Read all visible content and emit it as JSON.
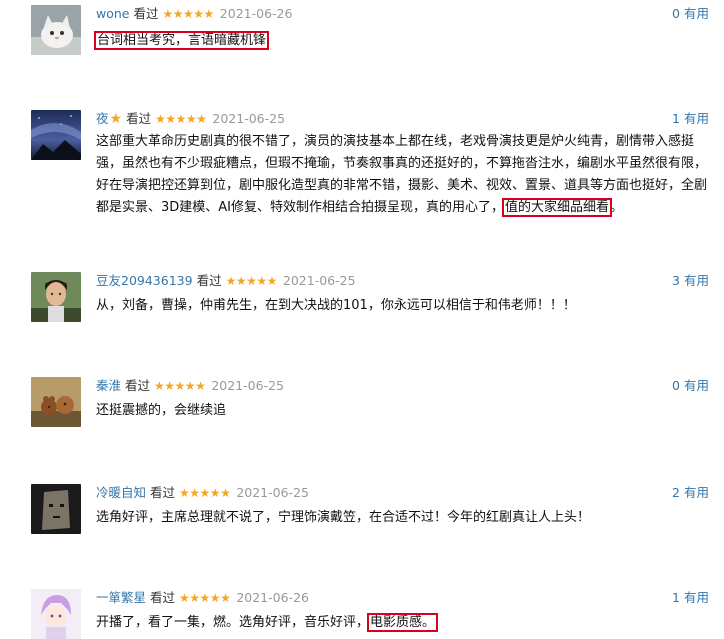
{
  "comments": [
    {
      "user": "wone",
      "seen": "看过",
      "stars": "★★★★★",
      "date": "2021-06-26",
      "votes": "0",
      "votes_label": "有用",
      "text_plain": "",
      "text_highlight": "台词相当考究，言语暗藏机锋",
      "avatar_icon": "cat-avatar-icon"
    },
    {
      "user": "夜",
      "badge_icon": "star-badge-icon",
      "seen": "看过",
      "stars": "★★★★★",
      "date": "2021-06-25",
      "votes": "1",
      "votes_label": "有用",
      "text_plain": "这部重大革命历史剧真的很不错了，演员的演技基本上都在线，老戏骨演技更是炉火纯青，剧情带入感挺强，虽然也有不少瑕疵糟点，但瑕不掩瑜，节奏叙事真的还挺好的，不算拖沓注水，编剧水平虽然很有限，好在导演把控还算到位，剧中服化造型真的非常不错，摄影、美术、视效、置景、道具等方面也挺好，全剧都是实景、3D建模、AI修复、特效制作相结合拍摄呈现，真的用心了，",
      "text_highlight": "值的大家细品细看",
      "text_tail": "。",
      "avatar_icon": "night-sky-avatar-icon"
    },
    {
      "user": "豆友209436139",
      "seen": "看过",
      "stars": "★★★★★",
      "date": "2021-06-25",
      "votes": "3",
      "votes_label": "有用",
      "text_plain": "从，刘备，曹操，仲甫先生，在到大决战的101，你永远可以相信于和伟老师！！！",
      "avatar_icon": "portrait-avatar-icon"
    },
    {
      "user": "秦淮",
      "seen": "看过",
      "stars": "★★★★★",
      "date": "2021-06-25",
      "votes": "0",
      "votes_label": "有用",
      "text_plain": "还挺震撼的，会继续追",
      "avatar_icon": "cartoon-avatar-icon"
    },
    {
      "user": "冷暖自知",
      "seen": "看过",
      "stars": "★★★★★",
      "date": "2021-06-25",
      "votes": "2",
      "votes_label": "有用",
      "text_plain": "选角好评，主席总理就不说了，宁理饰演戴笠，在合适不过！今年的红剧真让人上头！",
      "avatar_icon": "bag-head-avatar-icon"
    },
    {
      "user": "一箪繁星",
      "seen": "看过",
      "stars": "★★★★★",
      "date": "2021-06-26",
      "votes": "1",
      "votes_label": "有用",
      "text_plain": "开播了，看了一集，燃。选角好评，音乐好评，",
      "text_highlight": "电影质感。",
      "avatar_icon": "anime-avatar-icon"
    }
  ],
  "colors": {
    "link": "#3377aa",
    "star": "#f5a623",
    "highlight_border": "#d9001b",
    "date": "#999999"
  }
}
